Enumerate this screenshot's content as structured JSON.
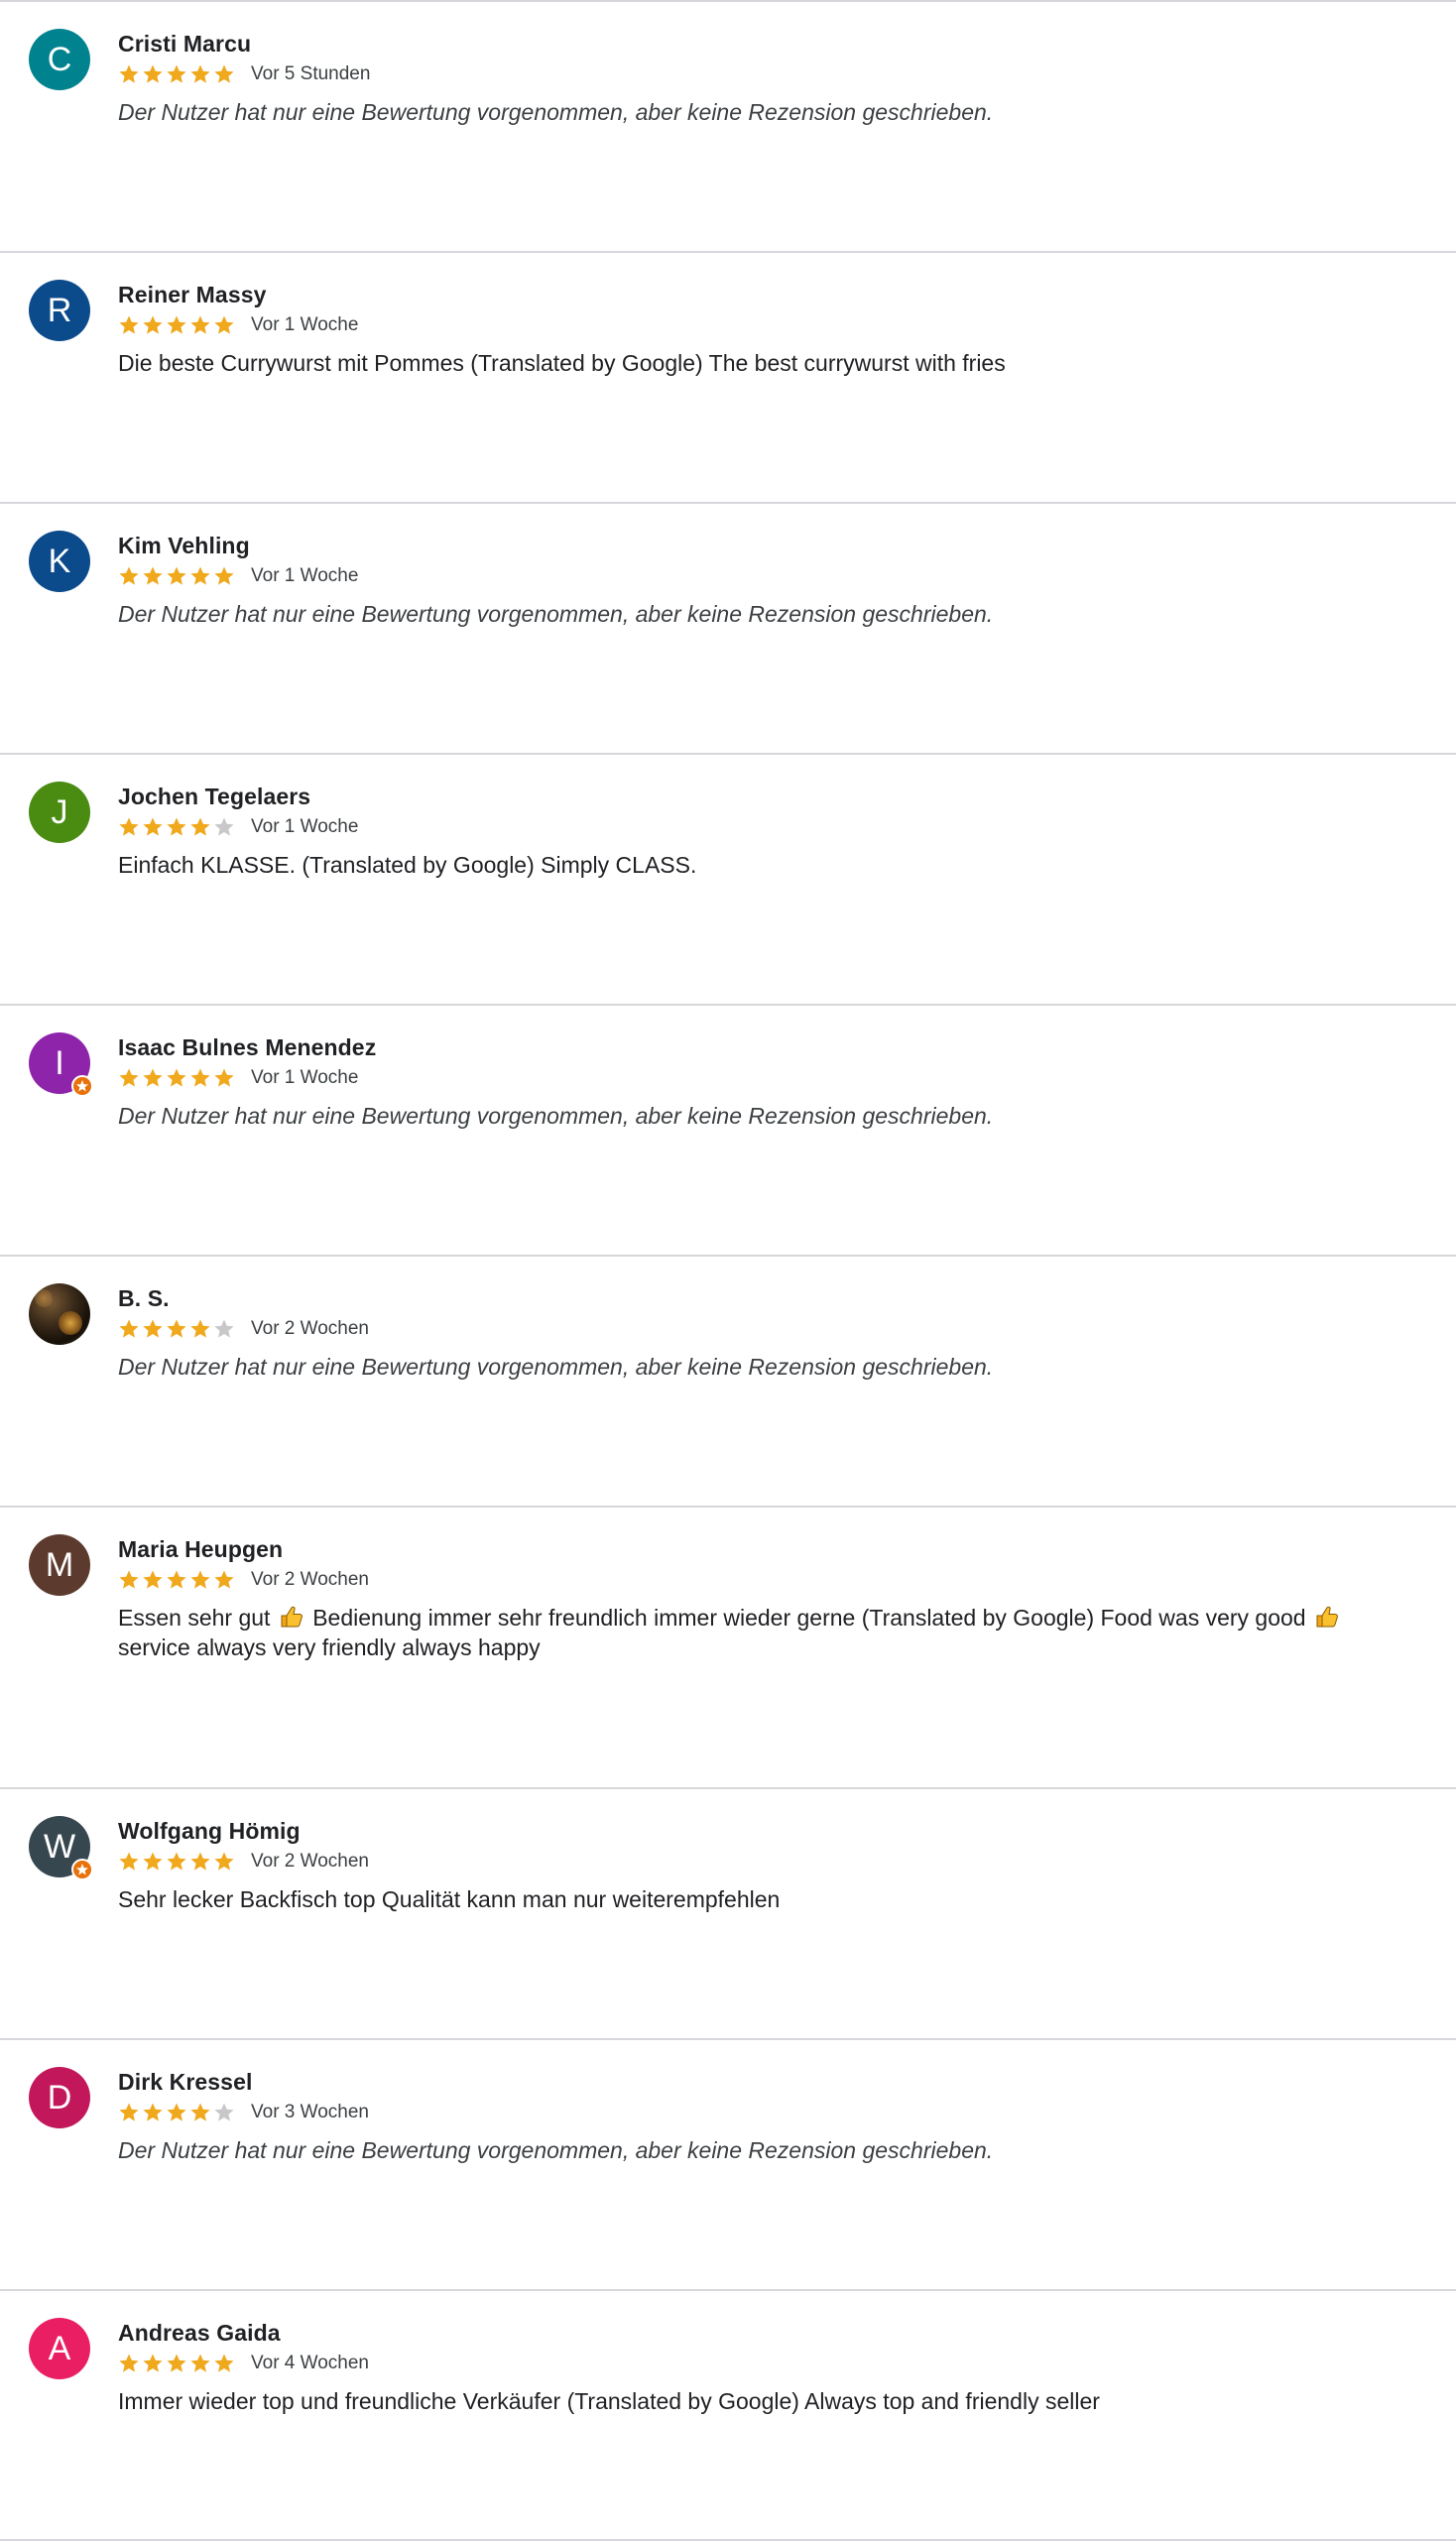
{
  "colors": {
    "star_filled": "#f0a81c",
    "star_empty": "#c8c8c8",
    "divider": "#d5d7da",
    "guide_badge": "#e8710a"
  },
  "reviews": [
    {
      "name": "Cristi Marcu",
      "initial": "C",
      "avatar_color": "#00838f",
      "rating": 5,
      "date": "Vor 5 Stunden",
      "text": "Der Nutzer hat nur eine Bewertung vorgenommen, aber keine Rezension geschrieben.",
      "placeholder": true,
      "local_guide": false,
      "photo": false
    },
    {
      "name": "Reiner Massy",
      "initial": "R",
      "avatar_color": "#0b4a8b",
      "rating": 5,
      "date": "Vor 1 Woche",
      "text": "Die beste Currywurst mit Pommes (Translated by Google) The best currywurst with fries",
      "placeholder": false,
      "local_guide": false,
      "photo": false
    },
    {
      "name": "Kim Vehling",
      "initial": "K",
      "avatar_color": "#0b4a8b",
      "rating": 5,
      "date": "Vor 1 Woche",
      "text": "Der Nutzer hat nur eine Bewertung vorgenommen, aber keine Rezension geschrieben.",
      "placeholder": true,
      "local_guide": false,
      "photo": false
    },
    {
      "name": "Jochen Tegelaers",
      "initial": "J",
      "avatar_color": "#4a8b12",
      "rating": 4,
      "date": "Vor 1 Woche",
      "text": "Einfach KLASSE. (Translated by Google) Simply CLASS.",
      "placeholder": false,
      "local_guide": false,
      "photo": false
    },
    {
      "name": "Isaac Bulnes Menendez",
      "initial": "I",
      "avatar_color": "#8e24aa",
      "rating": 5,
      "date": "Vor 1 Woche",
      "text": "Der Nutzer hat nur eine Bewertung vorgenommen, aber keine Rezension geschrieben.",
      "placeholder": true,
      "local_guide": true,
      "photo": false
    },
    {
      "name": "B. S.",
      "initial": "",
      "avatar_color": "#3a2a1a",
      "rating": 4,
      "date": "Vor 2 Wochen",
      "text": "Der Nutzer hat nur eine Bewertung vorgenommen, aber keine Rezension geschrieben.",
      "placeholder": true,
      "local_guide": false,
      "photo": true
    },
    {
      "name": "Maria Heupgen",
      "initial": "M",
      "avatar_color": "#5d3a2e",
      "rating": 5,
      "date": "Vor 2 Wochen",
      "text_parts": [
        "Essen sehr gut ",
        " Bedienung immer sehr freundlich immer wieder gerne (Translated by Google) Food was very good ",
        " service always very friendly always happy"
      ],
      "placeholder": false,
      "local_guide": false,
      "photo": false
    },
    {
      "name": "Wolfgang Hömig",
      "initial": "W",
      "avatar_color": "#37474f",
      "rating": 5,
      "date": "Vor 2 Wochen",
      "text": "Sehr lecker Backfisch top Qualität kann man nur weiterempfehlen",
      "placeholder": false,
      "local_guide": true,
      "photo": false
    },
    {
      "name": "Dirk Kressel",
      "initial": "D",
      "avatar_color": "#c2185b",
      "rating": 4,
      "date": "Vor 3 Wochen",
      "text": "Der Nutzer hat nur eine Bewertung vorgenommen, aber keine Rezension geschrieben.",
      "placeholder": true,
      "local_guide": false,
      "photo": false
    },
    {
      "name": "Andreas Gaida",
      "initial": "A",
      "avatar_color": "#e91e63",
      "rating": 5,
      "date": "Vor 4 Wochen",
      "text": "Immer wieder top und freundliche Verkäufer (Translated by Google) Always top and friendly seller",
      "placeholder": false,
      "local_guide": false,
      "photo": false
    }
  ]
}
